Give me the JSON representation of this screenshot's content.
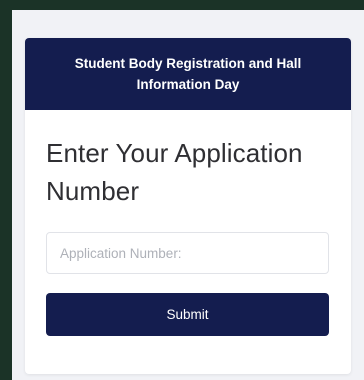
{
  "card": {
    "header_title": "Student Body Registration and Hall Information Day",
    "prompt": "Enter Your Application Number",
    "application_input": {
      "value": "",
      "placeholder": "Application Number:"
    },
    "submit_label": "Submit"
  },
  "colors": {
    "outer_background": "#1b3327",
    "panel_background": "#f1f2f6",
    "brand_navy": "#141d4f",
    "card_background": "#ffffff"
  }
}
